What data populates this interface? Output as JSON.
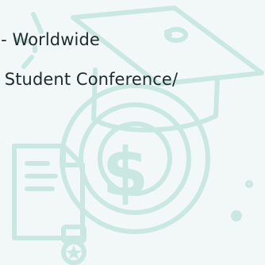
{
  "text": {
    "line1": "t - Worldwide",
    "line2": "e Student Conference/"
  },
  "icons": {
    "cap": "graduation-cap-icon",
    "dollar": "dollar-sign-icon",
    "document": "certificate-document-icon",
    "medal": "medal-star-icon"
  },
  "colors": {
    "background": "#f1f8f7",
    "illustration": "#c9e8e1",
    "text": "#1f2a2a"
  }
}
